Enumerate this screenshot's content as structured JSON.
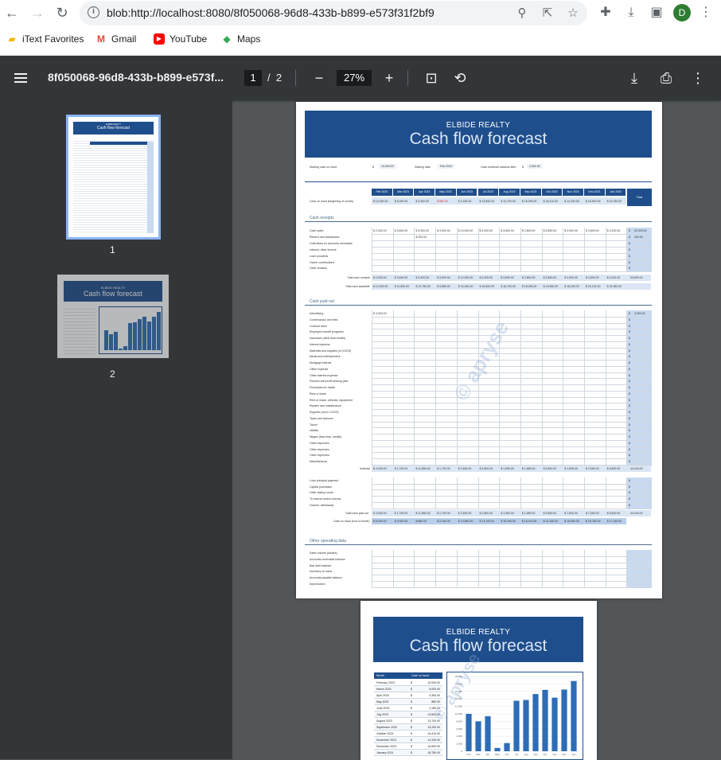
{
  "browser": {
    "url": "blob:http://localhost:8080/8f050068-96d8-433b-b899-e573f31f2bf9",
    "avatar_letter": "D",
    "bookmarks": [
      {
        "label": "iText Favorites",
        "icon": "folder-icon",
        "color": "#f4b400"
      },
      {
        "label": "Gmail",
        "icon": "gmail-icon",
        "color": "#ea4335"
      },
      {
        "label": "YouTube",
        "icon": "youtube-icon",
        "color": "#ff0000"
      },
      {
        "label": "Maps",
        "icon": "maps-icon",
        "color": "#34a853"
      }
    ]
  },
  "pdf_toolbar": {
    "doc_title": "8f050068-96d8-433b-b899-e573f...",
    "current_page": "1",
    "page_separator": "/",
    "total_pages": "2",
    "zoom": "27%"
  },
  "sidebar": {
    "thumbnails": [
      {
        "label": "1",
        "company": "ELBIDE REALTY",
        "title": "Cash flow forecast"
      },
      {
        "label": "2",
        "company": "ELBIDE REALTY",
        "title": "Cash flow forecast"
      }
    ]
  },
  "page1": {
    "company": "ELBIDE REALTY",
    "title": "Cash flow forecast",
    "inputs": {
      "starting_cash_label": "Starting cash on hand",
      "starting_cash_symbol": "$",
      "starting_cash_value": "10,000.00",
      "starting_date_label": "Starting date",
      "starting_date_value": "Feb 2023",
      "cash_min_label": "Cash minimum balance alert",
      "cash_min_symbol": "$",
      "cash_min_value": "2,500.00"
    },
    "months": [
      "Feb 2023",
      "Mar 2023",
      "Apr 2023",
      "May 2023",
      "Jun 2023",
      "Jul 2023",
      "Aug 2023",
      "Sep 2023",
      "Oct 2023",
      "Nov 2023",
      "Dec 2023",
      "Jan 2024"
    ],
    "total_label": "Total",
    "beginning_label": "Cash on hand (beginning of month)",
    "beginning_values": [
      "10,000.00",
      "8,000.00",
      "9,350.00",
      "880.00",
      "2,180.00",
      "13,500.00",
      "13,700.00",
      "15,290.00",
      "16,410.00",
      "14,330.00",
      "16,500.00",
      "18,780.00"
    ],
    "receipts_title": "Cash receipts",
    "receipts_rows": [
      "Cash sales",
      "Returns and allowances",
      "Collections on accounts receivable",
      "Interest, other income",
      "Loan proceeds",
      "Owner contributions",
      "Other receipts"
    ],
    "cash_sales_values": [
      "2,000.00",
      "3,600.00",
      "3,000.00",
      "3,000.00",
      "14,000.00",
      "3,000.00",
      "3,600.00",
      "2,800.00",
      "3,550.00",
      "4,000.00",
      "3,600.00",
      "4,200.00"
    ],
    "cash_sales_total": "53,400.00",
    "returns_value": "200.00",
    "returns_total": "200.00",
    "total_receipts_label": "Total cash receipts",
    "total_receipts_values": [
      "2,000.00",
      "3,600.00",
      "3,400.00",
      "3,000.00",
      "14,000.00",
      "3,000.00",
      "3,600.00",
      "2,800.00",
      "3,550.00",
      "4,000.00",
      "3,600.00",
      "4,200.00"
    ],
    "total_receipts_total": "53,600.00",
    "total_available_label": "Total cash available",
    "total_available_values": [
      "12,000.00",
      "11,600.00",
      "12,750.00",
      "3,880.00",
      "16,180.00",
      "16,500.00",
      "16,700.00",
      "18,090.00",
      "19,960.00",
      "18,330.00",
      "20,100.00",
      "22,980.00"
    ],
    "paidout_title": "Cash paid out",
    "paidout_rows": [
      "Advertising",
      "Commissions and fees",
      "Contract labor",
      "Employee benefit programs",
      "Insurance (other than health)",
      "Interest expense",
      "Materials and supplies (in COGS)",
      "Meals and entertainment",
      "Mortgage interest",
      "Office expense",
      "Other interest expense",
      "Pension and profit-sharing plan",
      "Purchases for resale",
      "Rent or lease",
      "Rent or lease: vehicles, equipment",
      "Repairs and maintenance",
      "Supplies (not in COGS)",
      "Taxes and licenses",
      "Travel",
      "Utilities",
      "Wages (less emp. credits)",
      "Other expenses",
      "Other expenses",
      "Other expenses",
      "Miscellaneous"
    ],
    "advertising_value": "3,000.00",
    "advertising_total": "3,000.00",
    "subtotal_label": "Subtotal",
    "subtotal_values": [
      "4,000.00",
      "1,700.00",
      "11,850.00",
      "1,700.00",
      "2,600.00",
      "2,800.00",
      "1,500.00",
      "1,680.00",
      "5,550.00",
      "1,830.00",
      "2,060.00",
      "5,820.00"
    ],
    "subtotal_total": "43,040.00",
    "other_rows": [
      "Loan principal payment",
      "Capital purchases",
      "Other startup costs",
      "To reserve and/or escrow",
      "Owners' withdrawal"
    ],
    "total_paid_label": "Total cash paid out",
    "end_label": "Cash on hand (end of month)",
    "end_values": [
      "8,000.00",
      "9,900.00",
      "880.00",
      "2,180.00",
      "13,550.00",
      "13,700.00",
      "15,290.00",
      "16,410.00",
      "14,330.00",
      "16,500.00",
      "18,780.00",
      "17,160.00"
    ],
    "operating_title": "Other operating data",
    "operating_rows": [
      "Sales volume (dollars)",
      "Accounts receivable balance",
      "Bad debt balance",
      "Inventory on hand",
      "Accounts payable balance",
      "Depreciation"
    ],
    "watermark": "© apryse"
  },
  "page2": {
    "company": "ELBIDE REALTY",
    "title": "Cash flow forecast",
    "table_headers": [
      "Month",
      "Cash on hand"
    ],
    "rows": [
      {
        "month": "February 2023",
        "symbol": "$",
        "value": "10,000.00"
      },
      {
        "month": "March 2023",
        "symbol": "$",
        "value": "8,000.00"
      },
      {
        "month": "April 2023",
        "symbol": "$",
        "value": "9,350.00"
      },
      {
        "month": "May 2023",
        "symbol": "$",
        "value": "880.00"
      },
      {
        "month": "June 2023",
        "symbol": "$",
        "value": "2,180.00"
      },
      {
        "month": "July 2023",
        "symbol": "$",
        "value": "13,500.00"
      },
      {
        "month": "August 2023",
        "symbol": "$",
        "value": "13,700.00"
      },
      {
        "month": "September 2023",
        "symbol": "$",
        "value": "15,290.00"
      },
      {
        "month": "October 2023",
        "symbol": "$",
        "value": "16,410.00"
      },
      {
        "month": "November 2023",
        "symbol": "$",
        "value": "14,330.00"
      },
      {
        "month": "December 2023",
        "symbol": "$",
        "value": "16,500.00"
      },
      {
        "month": "January 2024",
        "symbol": "$",
        "value": "18,780.00"
      }
    ]
  },
  "chart_data": {
    "type": "bar",
    "categories": [
      "Feb",
      "Mar",
      "Apr",
      "May",
      "Jun",
      "Jul",
      "Aug",
      "Sep",
      "Oct",
      "Nov",
      "Dec",
      "Jan"
    ],
    "values": [
      10000,
      8000,
      9350,
      880,
      2180,
      13500,
      13700,
      15290,
      16410,
      14330,
      16500,
      18780
    ],
    "ylim": [
      0,
      20000
    ],
    "yticks": [
      "0",
      "2,000",
      "4,000",
      "6,000",
      "8,000",
      "10,000",
      "12,000",
      "14,000",
      "16,000",
      "18,000",
      "20,000"
    ],
    "grid": true,
    "bar_color": "#2e6db5"
  }
}
